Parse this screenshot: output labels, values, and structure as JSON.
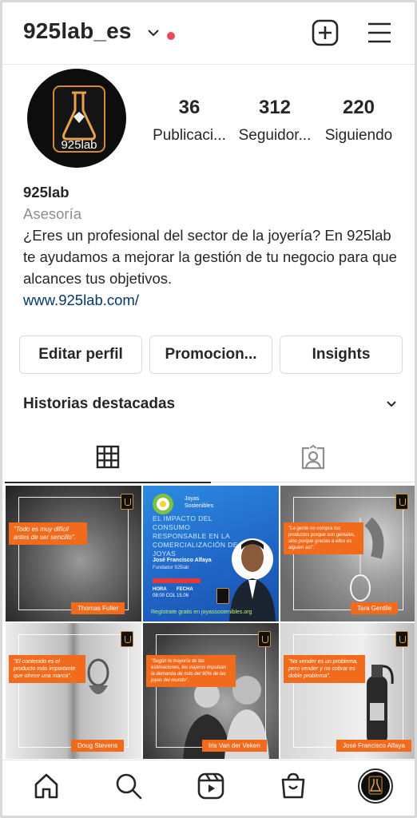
{
  "header": {
    "username": "925lab_es"
  },
  "profile": {
    "avatar_text": "925lab",
    "stats": [
      {
        "value": "36",
        "label": "Publicaci..."
      },
      {
        "value": "312",
        "label": "Seguidor..."
      },
      {
        "value": "220",
        "label": "Siguiendo"
      }
    ],
    "name": "925lab",
    "category": "Asesoría",
    "bio": "¿Eres un profesional del sector de la joyería? En 925lab te ayudamos a mejorar la gestión de tu negocio para que alcances tus objetivos.",
    "website": "www.925lab.com/"
  },
  "actions": {
    "edit": "Editar perfil",
    "promote": "Promocion...",
    "insights": "Insights"
  },
  "highlights": {
    "title": "Historias destacadas"
  },
  "posts": [
    {
      "quote": "\"Todo es muy difícil antes de ser sencillo\".",
      "author": "Thomas Fuller"
    },
    {
      "title": "EL IMPACTO DEL CONSUMO RESPONSABLE EN LA COMERCIALIZACIÓN DE JOYAS",
      "brand": "Joyas Sostenibles",
      "speaker": "José Francisco Alfaya",
      "role": "Fundador 925lab",
      "hora_label": "HORA",
      "hora_value": "08:00 COL",
      "fecha_label": "FECHA",
      "fecha_value": "15.06",
      "cta": "Regístrate gratis en joyassostenibles.org"
    },
    {
      "quote": "\"La gente no compra tus productos porque son geniales, sino porque gracias a ellos es alguien así\".",
      "author": "Tara Gentile"
    },
    {
      "quote": "\"El contenido es el producto más importante que ofrece una marca\".",
      "author": "Doug Stevens"
    },
    {
      "quote": "\"Según la mayoría de las estimaciones, los viajeros impulsan la demanda de más del 90% de las joyas del mundo\".",
      "author": "Iris Van der Veken"
    },
    {
      "quote": "\"No vender es un problema, pero vender y no cobrar es doble problema\".",
      "author": "José Francisco Alfaya"
    }
  ],
  "colors": {
    "accent_orange": "#f26b1d",
    "link": "#00376b",
    "notification": "#ed4956"
  }
}
